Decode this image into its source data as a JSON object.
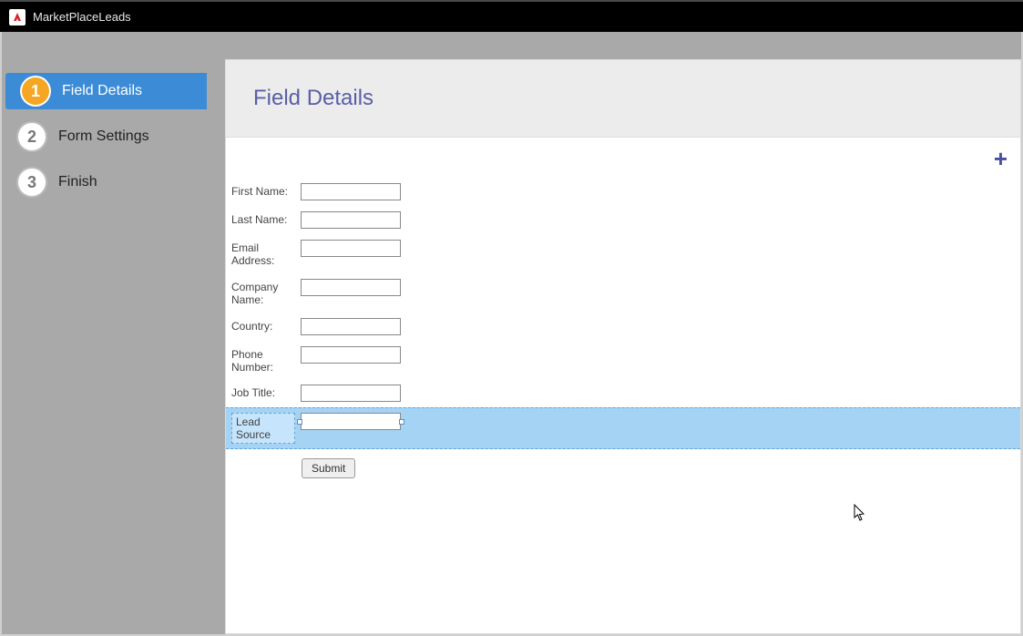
{
  "titlebar": {
    "title": "MarketPlaceLeads"
  },
  "sidebar": {
    "steps": [
      {
        "num": "1",
        "label": "Field Details"
      },
      {
        "num": "2",
        "label": "Form Settings"
      },
      {
        "num": "3",
        "label": "Finish"
      }
    ]
  },
  "main": {
    "heading": "Field Details",
    "add_icon": "+",
    "fields": [
      {
        "label": "First Name:",
        "value": ""
      },
      {
        "label": "Last Name:",
        "value": ""
      },
      {
        "label": "Email Address:",
        "value": ""
      },
      {
        "label": "Company Name:",
        "value": ""
      },
      {
        "label": "Country:",
        "value": ""
      },
      {
        "label": "Phone Number:",
        "value": ""
      },
      {
        "label": "Job Title:",
        "value": ""
      }
    ],
    "selected_field": {
      "label": "Lead Source",
      "value": ""
    },
    "submit_label": "Submit"
  }
}
